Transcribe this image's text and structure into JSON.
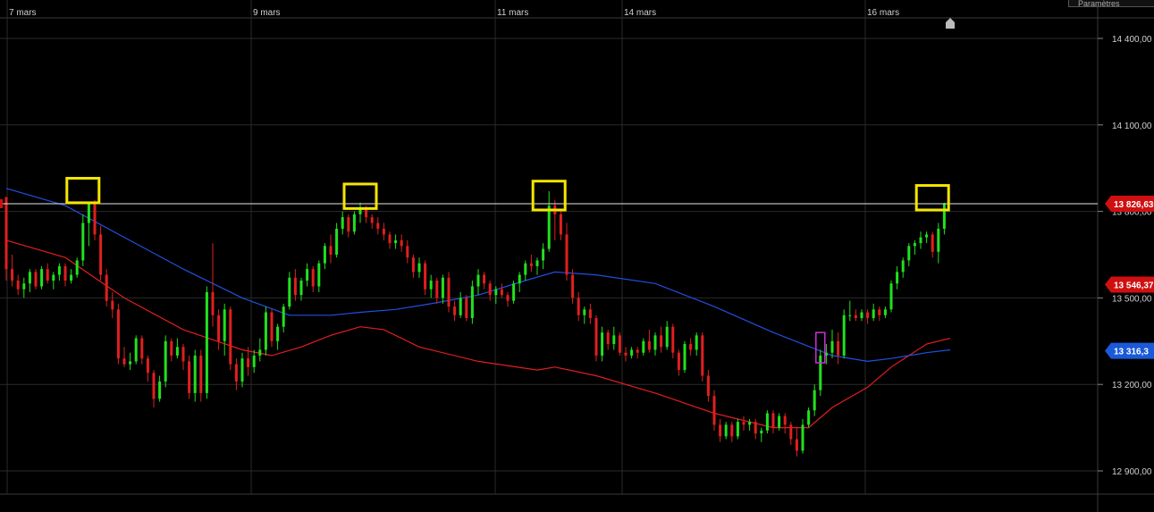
{
  "toolbar": {
    "settings_label": "Paramètres"
  },
  "colors": {
    "background": "#000000",
    "grid": "#2a2a2a",
    "axis_text": "#d0d0d0",
    "bull": "#22e01f",
    "bear": "#e01f1f",
    "ma_fast": "#e01f1f",
    "ma_slow": "#2050e0",
    "highlight": "#f5e600",
    "marker": "#c830d8"
  },
  "chart_data": {
    "type": "candlestick",
    "title": "",
    "xlabel": "",
    "ylabel": "",
    "ylim": [
      12850,
      14470
    ],
    "x_ticks": [
      "7 mars",
      "9 mars",
      "11 mars",
      "14 mars",
      "16 mars"
    ],
    "y_ticks": [
      "14 400,00",
      "14 100,00",
      "13 800,00",
      "13 500,00",
      "13 200,00",
      "12 900,00"
    ],
    "y_tick_values": [
      14400,
      14100,
      13800,
      13500,
      13200,
      12900
    ],
    "grid": true,
    "price_line": 13826.63,
    "price_labels": [
      {
        "text": "13 826,630",
        "value": 13826.63,
        "color": "#d01010"
      },
      {
        "text": "13 546,37",
        "value": 13546.37,
        "color": "#d01010"
      },
      {
        "text": "13 316,3",
        "value": 13316.3,
        "color": "#1a5ad8"
      }
    ],
    "highlight_boxes": [
      {
        "candle": 13,
        "low": 13830,
        "high": 13915
      },
      {
        "candle": 60,
        "low": 13810,
        "high": 13895
      },
      {
        "candle": 92,
        "low": 13805,
        "high": 13905
      },
      {
        "candle": 157,
        "low": 13805,
        "high": 13890
      }
    ],
    "purple_marker": {
      "candle": 138,
      "low": 13275,
      "high": 13380
    },
    "candles": [
      [
        13850,
        13835,
        13560,
        13600
      ],
      [
        13600,
        13650,
        13540,
        13560
      ],
      [
        13560,
        13580,
        13510,
        13530
      ],
      [
        13530,
        13570,
        13500,
        13550
      ],
      [
        13550,
        13600,
        13520,
        13590
      ],
      [
        13590,
        13600,
        13530,
        13540
      ],
      [
        13540,
        13610,
        13530,
        13600
      ],
      [
        13600,
        13620,
        13550,
        13560
      ],
      [
        13560,
        13590,
        13530,
        13580
      ],
      [
        13580,
        13620,
        13560,
        13610
      ],
      [
        13610,
        13620,
        13540,
        13560
      ],
      [
        13560,
        13600,
        13550,
        13580
      ],
      [
        13580,
        13640,
        13570,
        13630
      ],
      [
        13630,
        13790,
        13610,
        13760
      ],
      [
        13760,
        13830,
        13680,
        13830
      ],
      [
        13830,
        13840,
        13700,
        13720
      ],
      [
        13720,
        13750,
        13560,
        13580
      ],
      [
        13580,
        13600,
        13470,
        13490
      ],
      [
        13490,
        13520,
        13430,
        13460
      ],
      [
        13460,
        13480,
        13270,
        13290
      ],
      [
        13290,
        13330,
        13260,
        13270
      ],
      [
        13270,
        13310,
        13250,
        13280
      ],
      [
        13280,
        13370,
        13270,
        13360
      ],
      [
        13360,
        13370,
        13270,
        13290
      ],
      [
        13290,
        13300,
        13210,
        13240
      ],
      [
        13240,
        13250,
        13120,
        13150
      ],
      [
        13150,
        13230,
        13140,
        13210
      ],
      [
        13210,
        13370,
        13190,
        13350
      ],
      [
        13350,
        13360,
        13280,
        13300
      ],
      [
        13300,
        13360,
        13290,
        13330
      ],
      [
        13330,
        13340,
        13250,
        13280
      ],
      [
        13280,
        13300,
        13150,
        13170
      ],
      [
        13170,
        13320,
        13140,
        13300
      ],
      [
        13300,
        13320,
        13140,
        13170
      ],
      [
        13170,
        13540,
        13150,
        13520
      ],
      [
        13520,
        13690,
        13400,
        13440
      ],
      [
        13440,
        13460,
        13320,
        13350
      ],
      [
        13350,
        13480,
        13300,
        13460
      ],
      [
        13460,
        13470,
        13250,
        13270
      ],
      [
        13270,
        13290,
        13180,
        13210
      ],
      [
        13210,
        13310,
        13190,
        13290
      ],
      [
        13290,
        13330,
        13230,
        13260
      ],
      [
        13260,
        13320,
        13240,
        13300
      ],
      [
        13300,
        13360,
        13280,
        13320
      ],
      [
        13320,
        13470,
        13300,
        13450
      ],
      [
        13450,
        13460,
        13330,
        13350
      ],
      [
        13350,
        13410,
        13320,
        13400
      ],
      [
        13400,
        13480,
        13380,
        13470
      ],
      [
        13470,
        13590,
        13460,
        13570
      ],
      [
        13570,
        13600,
        13490,
        13510
      ],
      [
        13510,
        13570,
        13490,
        13560
      ],
      [
        13560,
        13620,
        13540,
        13600
      ],
      [
        13600,
        13610,
        13520,
        13540
      ],
      [
        13540,
        13630,
        13520,
        13620
      ],
      [
        13620,
        13690,
        13600,
        13680
      ],
      [
        13680,
        13720,
        13620,
        13650
      ],
      [
        13650,
        13760,
        13640,
        13740
      ],
      [
        13740,
        13800,
        13720,
        13780
      ],
      [
        13780,
        13790,
        13710,
        13730
      ],
      [
        13730,
        13800,
        13720,
        13790
      ],
      [
        13790,
        13830,
        13760,
        13810
      ],
      [
        13810,
        13820,
        13760,
        13780
      ],
      [
        13780,
        13790,
        13740,
        13760
      ],
      [
        13760,
        13780,
        13720,
        13740
      ],
      [
        13740,
        13760,
        13700,
        13720
      ],
      [
        13720,
        13730,
        13670,
        13690
      ],
      [
        13690,
        13720,
        13670,
        13700
      ],
      [
        13700,
        13720,
        13660,
        13680
      ],
      [
        13680,
        13700,
        13620,
        13640
      ],
      [
        13640,
        13650,
        13570,
        13590
      ],
      [
        13590,
        13640,
        13570,
        13620
      ],
      [
        13620,
        13630,
        13510,
        13530
      ],
      [
        13530,
        13580,
        13500,
        13560
      ],
      [
        13560,
        13570,
        13480,
        13500
      ],
      [
        13500,
        13580,
        13480,
        13570
      ],
      [
        13570,
        13590,
        13450,
        13470
      ],
      [
        13470,
        13490,
        13420,
        13440
      ],
      [
        13440,
        13520,
        13430,
        13500
      ],
      [
        13500,
        13510,
        13420,
        13430
      ],
      [
        13430,
        13560,
        13410,
        13540
      ],
      [
        13540,
        13600,
        13510,
        13580
      ],
      [
        13580,
        13590,
        13530,
        13550
      ],
      [
        13550,
        13560,
        13490,
        13510
      ],
      [
        13510,
        13540,
        13480,
        13530
      ],
      [
        13530,
        13550,
        13500,
        13510
      ],
      [
        13510,
        13520,
        13470,
        13490
      ],
      [
        13490,
        13560,
        13480,
        13550
      ],
      [
        13550,
        13590,
        13520,
        13580
      ],
      [
        13580,
        13630,
        13560,
        13620
      ],
      [
        13620,
        13650,
        13590,
        13610
      ],
      [
        13610,
        13640,
        13580,
        13630
      ],
      [
        13630,
        13690,
        13600,
        13670
      ],
      [
        13670,
        13870,
        13660,
        13820
      ],
      [
        13820,
        13840,
        13700,
        13790
      ],
      [
        13790,
        13800,
        13700,
        13720
      ],
      [
        13720,
        13760,
        13560,
        13580
      ],
      [
        13580,
        13600,
        13480,
        13500
      ],
      [
        13500,
        13520,
        13420,
        13440
      ],
      [
        13440,
        13470,
        13410,
        13460
      ],
      [
        13460,
        13480,
        13410,
        13430
      ],
      [
        13430,
        13440,
        13280,
        13300
      ],
      [
        13300,
        13400,
        13280,
        13380
      ],
      [
        13380,
        13390,
        13320,
        13340
      ],
      [
        13340,
        13400,
        13320,
        13370
      ],
      [
        13370,
        13380,
        13300,
        13310
      ],
      [
        13310,
        13330,
        13280,
        13300
      ],
      [
        13300,
        13330,
        13290,
        13320
      ],
      [
        13320,
        13330,
        13290,
        13310
      ],
      [
        13310,
        13360,
        13300,
        13350
      ],
      [
        13350,
        13390,
        13310,
        13320
      ],
      [
        13320,
        13380,
        13300,
        13370
      ],
      [
        13370,
        13400,
        13310,
        13330
      ],
      [
        13330,
        13420,
        13320,
        13400
      ],
      [
        13400,
        13410,
        13290,
        13310
      ],
      [
        13310,
        13320,
        13230,
        13250
      ],
      [
        13250,
        13350,
        13240,
        13340
      ],
      [
        13340,
        13360,
        13300,
        13320
      ],
      [
        13320,
        13380,
        13300,
        13370
      ],
      [
        13370,
        13380,
        13210,
        13230
      ],
      [
        13230,
        13250,
        13140,
        13160
      ],
      [
        13160,
        13180,
        13040,
        13060
      ],
      [
        13060,
        13080,
        13000,
        13020
      ],
      [
        13020,
        13070,
        13010,
        13060
      ],
      [
        13060,
        13070,
        13000,
        13020
      ],
      [
        13020,
        13080,
        13010,
        13070
      ],
      [
        13070,
        13090,
        13040,
        13060
      ],
      [
        13060,
        13080,
        13040,
        13070
      ],
      [
        13070,
        13080,
        13010,
        13030
      ],
      [
        13030,
        13050,
        13000,
        13040
      ],
      [
        13040,
        13110,
        13030,
        13100
      ],
      [
        13100,
        13110,
        13030,
        13050
      ],
      [
        13050,
        13100,
        13040,
        13090
      ],
      [
        13090,
        13100,
        13030,
        13060
      ],
      [
        13060,
        13070,
        12990,
        13010
      ],
      [
        13010,
        13050,
        12950,
        12970
      ],
      [
        12970,
        13080,
        12960,
        13060
      ],
      [
        13060,
        13120,
        13050,
        13110
      ],
      [
        13110,
        13200,
        13090,
        13180
      ],
      [
        13180,
        13320,
        13160,
        13300
      ],
      [
        13300,
        13340,
        13270,
        13310
      ],
      [
        13310,
        13390,
        13290,
        13350
      ],
      [
        13350,
        13380,
        13270,
        13300
      ],
      [
        13300,
        13460,
        13290,
        13440
      ],
      [
        13440,
        13490,
        13420,
        13440
      ],
      [
        13440,
        13460,
        13420,
        13430
      ],
      [
        13430,
        13460,
        13420,
        13450
      ],
      [
        13450,
        13460,
        13410,
        13430
      ],
      [
        13430,
        13480,
        13420,
        13460
      ],
      [
        13460,
        13470,
        13420,
        13440
      ],
      [
        13440,
        13470,
        13430,
        13460
      ],
      [
        13460,
        13560,
        13450,
        13550
      ],
      [
        13550,
        13610,
        13530,
        13590
      ],
      [
        13590,
        13640,
        13570,
        13630
      ],
      [
        13630,
        13690,
        13610,
        13680
      ],
      [
        13680,
        13700,
        13650,
        13690
      ],
      [
        13690,
        13730,
        13670,
        13710
      ],
      [
        13710,
        13730,
        13690,
        13720
      ],
      [
        13720,
        13730,
        13640,
        13660
      ],
      [
        13660,
        13760,
        13620,
        13740
      ],
      [
        13740,
        13830,
        13720,
        13826
      ]
    ],
    "series": [
      {
        "values": [
          [
            0,
            13700
          ],
          [
            10,
            13640
          ],
          [
            20,
            13500
          ],
          [
            30,
            13390
          ],
          [
            40,
            13320
          ],
          [
            45,
            13300
          ],
          [
            50,
            13330
          ],
          [
            55,
            13370
          ],
          [
            60,
            13400
          ],
          [
            64,
            13390
          ],
          [
            70,
            13330
          ],
          [
            80,
            13280
          ],
          [
            90,
            13250
          ],
          [
            93,
            13260
          ],
          [
            100,
            13230
          ],
          [
            110,
            13170
          ],
          [
            120,
            13100
          ],
          [
            130,
            13050
          ],
          [
            136,
            13050
          ],
          [
            140,
            13120
          ],
          [
            146,
            13190
          ],
          [
            150,
            13260
          ],
          [
            156,
            13340
          ],
          [
            160,
            13360
          ]
        ]
      },
      {
        "values": [
          [
            0,
            13880
          ],
          [
            10,
            13820
          ],
          [
            20,
            13710
          ],
          [
            30,
            13600
          ],
          [
            40,
            13500
          ],
          [
            48,
            13440
          ],
          [
            55,
            13440
          ],
          [
            60,
            13450
          ],
          [
            66,
            13460
          ],
          [
            72,
            13480
          ],
          [
            80,
            13510
          ],
          [
            88,
            13560
          ],
          [
            93,
            13590
          ],
          [
            100,
            13580
          ],
          [
            110,
            13550
          ],
          [
            120,
            13470
          ],
          [
            130,
            13380
          ],
          [
            140,
            13300
          ],
          [
            146,
            13280
          ],
          [
            150,
            13290
          ],
          [
            156,
            13310
          ],
          [
            160,
            13320
          ]
        ]
      }
    ]
  }
}
